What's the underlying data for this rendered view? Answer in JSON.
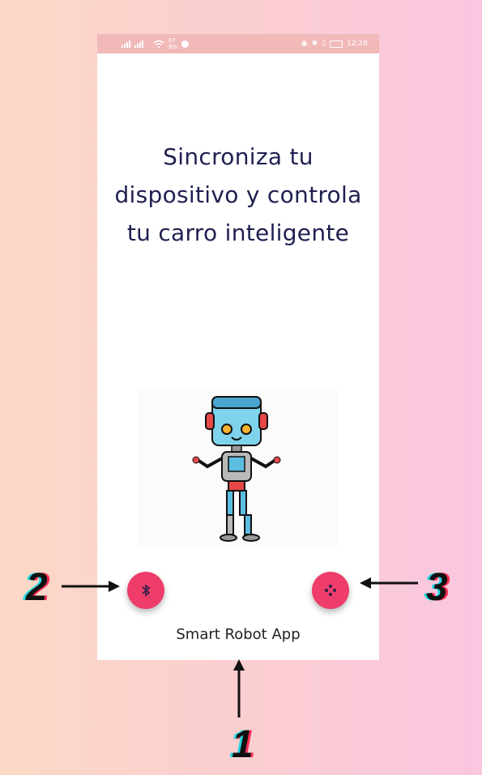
{
  "status_bar": {
    "left_text": "4G 4G 67 B/s",
    "right_text": "🔋 12:28",
    "time": "12:28"
  },
  "screen": {
    "headline": "Sincroniza tu dispositivo y controla tu carro inteligente",
    "footer": "Smart Robot App"
  },
  "buttons": {
    "bluetooth_icon": "bluetooth-icon",
    "gamepad_icon": "gamepad-icon"
  },
  "callouts": {
    "one": "1",
    "two": "2",
    "three": "3"
  },
  "colors": {
    "accent": "#ee3d6a",
    "status_bar": "#f2b9b9",
    "headline": "#1f2050"
  }
}
